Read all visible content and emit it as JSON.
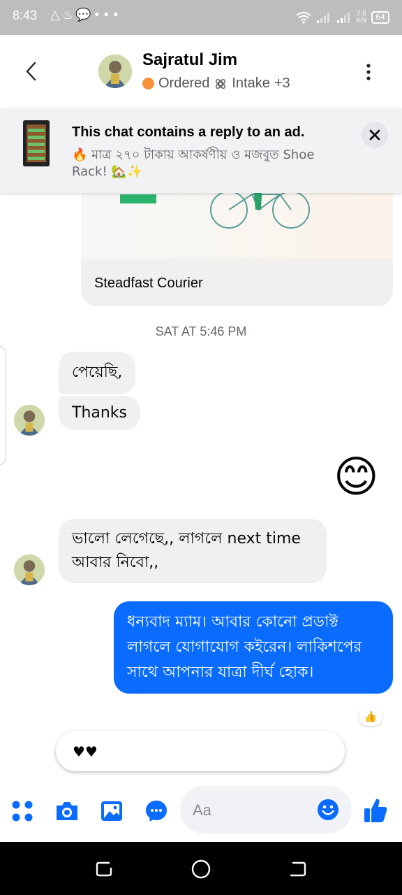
{
  "status_bar": {
    "time": "8:43",
    "net_speed": "7.6",
    "net_unit": "K/s",
    "battery": "64"
  },
  "header": {
    "contact_name": "Sajratul Jim",
    "label_ordered": "Ordered",
    "label_intake": "Intake",
    "more_labels": "+3"
  },
  "ad_banner": {
    "title": "This chat contains a reply to an ad.",
    "text": "🔥 মাত্র ২৭০ টাকায় আকর্ষণীয় ও মজবুত Shoe Rack! 🏡✨"
  },
  "messages": {
    "courier_card_label": "Steadfast Courier",
    "timestamp": "SAT AT 5:46 PM",
    "in1": "পেয়েছি,",
    "in2": "Thanks",
    "emoji": "😊",
    "in3": "ভালো লেগেছে,, লাগলে next time আবার নিবো,,",
    "out1": "ধন্যবাদ ম্যাম। আবার কোনো প্রডাক্ট লাগলে যোগাযোগ কইরেন। লাকিশপের সাথে আপনার যাত্রা দীর্ঘ হোক।",
    "reaction": "👍"
  },
  "composer": {
    "reply_text": "♥♥",
    "placeholder": "Aa"
  },
  "colors": {
    "accent": "#0a6cff",
    "incoming_bubble": "#f0f0f0",
    "ordered_dot": "#f7923a"
  }
}
